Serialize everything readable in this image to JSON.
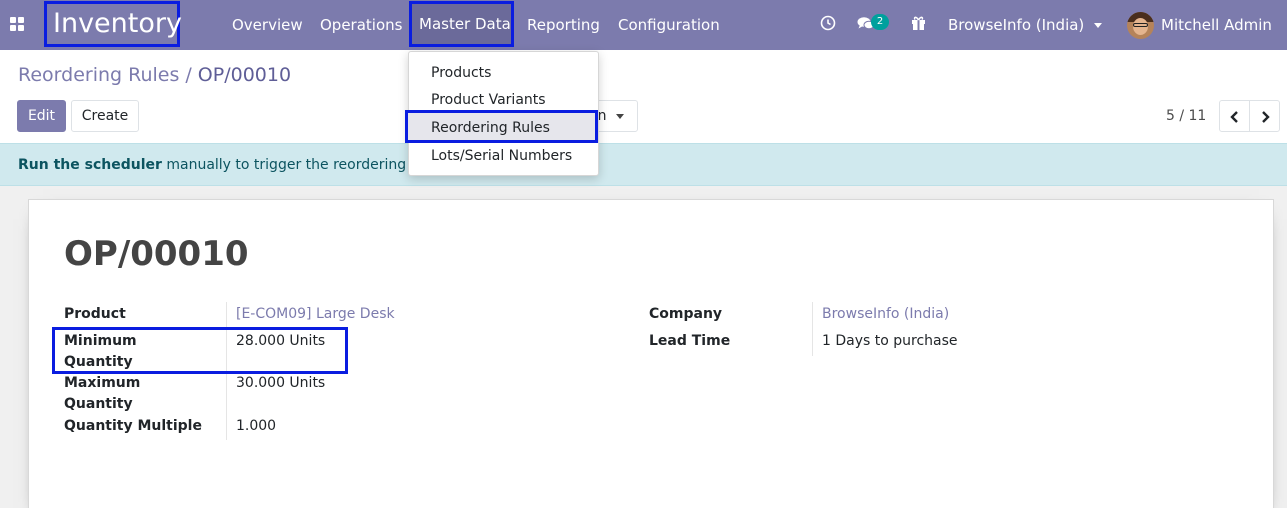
{
  "app": {
    "name": "Inventory",
    "menu": [
      "Overview",
      "Operations",
      "Master Data",
      "Reporting",
      "Configuration"
    ],
    "notification_count": "2",
    "company": "BrowseInfo (India)",
    "user": "Mitchell Admin",
    "colors": {
      "brand": "#7c7bad",
      "highlight": "#0a1de0",
      "alert_bg": "#d0e9ee"
    }
  },
  "master_data_dropdown": {
    "items": [
      "Products",
      "Product Variants",
      "Reordering Rules",
      "Lots/Serial Numbers"
    ],
    "active_index": 2
  },
  "breadcrumb": {
    "parent": "Reordering Rules",
    "separator": "/",
    "current": "OP/00010"
  },
  "buttons": {
    "edit": "Edit",
    "create": "Create",
    "action_partial": "on"
  },
  "pager": {
    "value": "5 / 11"
  },
  "alert": {
    "bold": "Run the scheduler",
    "text": "manually to trigger the reordering"
  },
  "record": {
    "title": "OP/00010",
    "left": [
      {
        "label": "Product",
        "value": "[E-COM09] Large Desk",
        "link": true
      },
      {
        "label": "Minimum Quantity",
        "value": "28.000 Units"
      },
      {
        "label": "Maximum Quantity",
        "value": "30.000 Units"
      },
      {
        "label": "Quantity Multiple",
        "value": "1.000"
      }
    ],
    "right": [
      {
        "label": "Company",
        "value": "BrowseInfo (India)",
        "link": true
      },
      {
        "label": "Lead Time",
        "value": "1 Days to purchase"
      }
    ]
  }
}
